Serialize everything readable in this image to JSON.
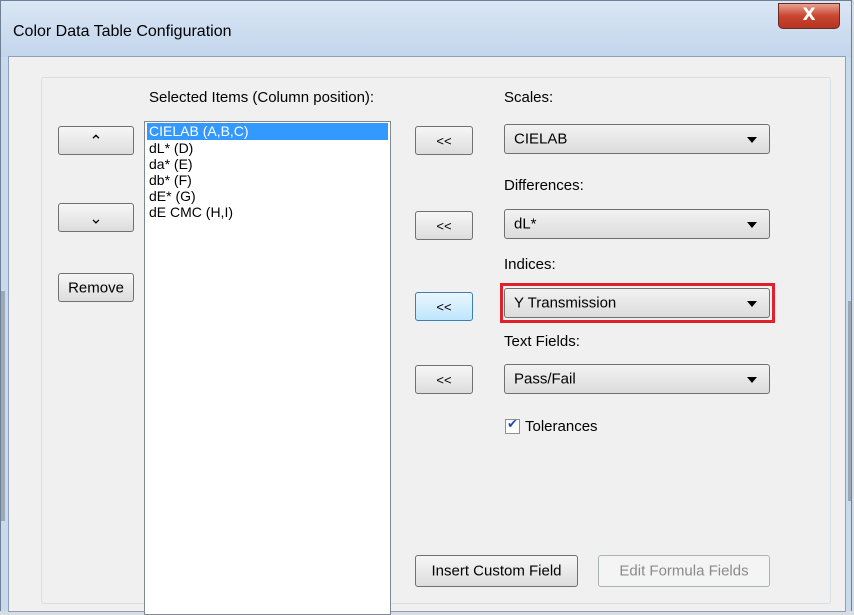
{
  "window": {
    "title": "Color Data Table Configuration",
    "close_symbol": "X"
  },
  "selected_items": {
    "label": "Selected Items (Column position):",
    "items": [
      "CIELAB (A,B,C)",
      "dL* (D)",
      "da* (E)",
      "db* (F)",
      "dE* (G)",
      "dE CMC (H,I)"
    ],
    "selected_index": 0
  },
  "buttons": {
    "move_up_symbol": "⌃",
    "move_down_symbol": "⌄",
    "remove": "Remove",
    "add_symbol": "<<",
    "insert_custom_field": "Insert Custom Field",
    "edit_formula_fields": "Edit Formula Fields"
  },
  "scales": {
    "label": "Scales:",
    "value": "CIELAB"
  },
  "differences": {
    "label": "Differences:",
    "value": "dL*"
  },
  "indices": {
    "label": "Indices:",
    "value": "Y Transmission"
  },
  "text_fields": {
    "label": "Text Fields:",
    "value": "Pass/Fail"
  },
  "tolerances": {
    "label": "Tolerances",
    "checked": true
  },
  "colors": {
    "highlight": "#e0202b",
    "selection": "#3399ff"
  }
}
